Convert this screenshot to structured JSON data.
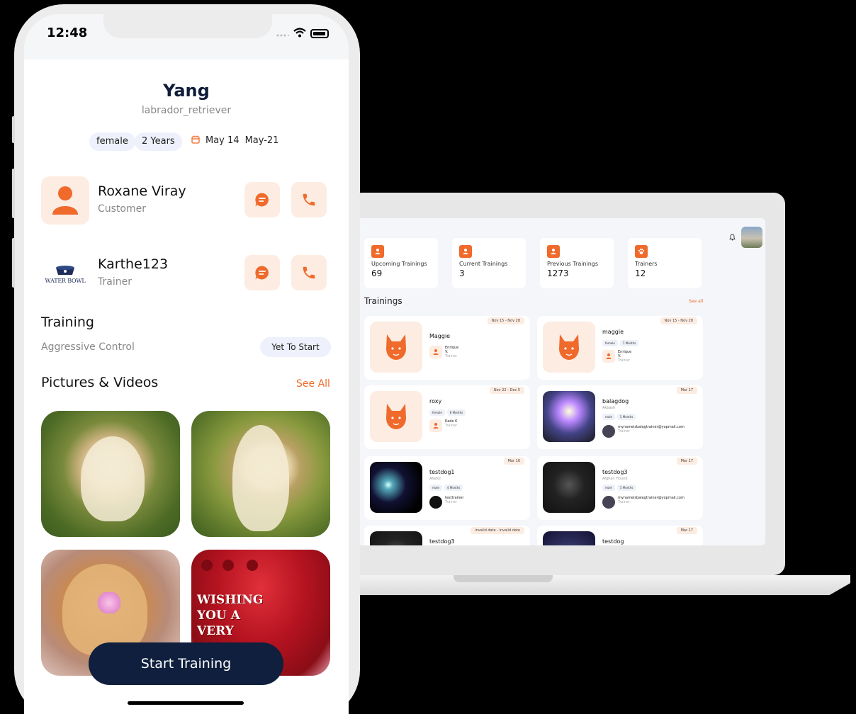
{
  "phone": {
    "status": {
      "time": "12:48"
    },
    "pet": {
      "name": "Yang",
      "breed": "labrador_retriever",
      "gender": "female",
      "age": "2 Years",
      "date1": "May 14",
      "date2": "May-21"
    },
    "customer": {
      "name": "Roxane Viray",
      "role": "Customer"
    },
    "trainer": {
      "name": "Karthe123",
      "role": "Trainer",
      "logo_text": "WATER BOWL"
    },
    "training": {
      "title": "Training",
      "name": "Aggressive Control",
      "status": "Yet To Start"
    },
    "media": {
      "title": "Pictures & Videos",
      "see_all": "See All",
      "xmas_text": "WISHING YOU A VERY"
    },
    "start_button": "Start Training"
  },
  "dashboard": {
    "stats": [
      {
        "label": "Upcoming Trainings",
        "value": "69",
        "icon": "person-icon"
      },
      {
        "label": "Current Trainings",
        "value": "3",
        "icon": "person-icon"
      },
      {
        "label": "Previous Trainings",
        "value": "1273",
        "icon": "person-icon"
      },
      {
        "label": "Trainers",
        "value": "12",
        "icon": "paw-icon"
      }
    ],
    "section_title": "Trainings",
    "see_all": "See all",
    "cards": [
      {
        "date": "Nov 15 - Nov 28",
        "name": "Maggie",
        "breed": "",
        "chips": [],
        "trainer": "Enrique V.",
        "role": "Trainer"
      },
      {
        "date": "Nov 15 - Nov 28",
        "name": "maggie",
        "breed": "",
        "chips": [
          "female",
          "7 Months"
        ],
        "trainer": "Enrique V.",
        "role": "Trainer"
      },
      {
        "date": "Nov 22 - Dec 5",
        "name": "roxy",
        "breed": "",
        "chips": [
          "female",
          "8 Months"
        ],
        "trainer": "Kade K",
        "role": "Trainer"
      },
      {
        "date": "Mar 17",
        "name": "balagdog",
        "breed": "Akbash",
        "chips": [
          "male",
          "5 Months"
        ],
        "trainer": "mynameisbalagtrainer@yopmail.com",
        "role": "Trainer"
      },
      {
        "date": "Mar 16",
        "name": "testdog1",
        "breed": "Afador",
        "chips": [
          "male",
          "4 Months"
        ],
        "trainer": "testtrainer",
        "role": "Trainer"
      },
      {
        "date": "Mar 17",
        "name": "testdog3",
        "breed": "Afghan Hound",
        "chips": [
          "male",
          "5 Months"
        ],
        "trainer": "mynameisbalagtrainer@yopmail.com",
        "role": "Trainer"
      },
      {
        "date": "invalid date - invalid date",
        "name": "testdog3",
        "breed": "",
        "chips": [],
        "trainer": "",
        "role": ""
      },
      {
        "date": "Mar 17",
        "name": "testdog",
        "breed": "",
        "chips": [],
        "trainer": "",
        "role": ""
      }
    ]
  },
  "colors": {
    "accent": "#ef6a2b",
    "navy": "#0f1f3d",
    "accent_soft": "#fdece2"
  }
}
